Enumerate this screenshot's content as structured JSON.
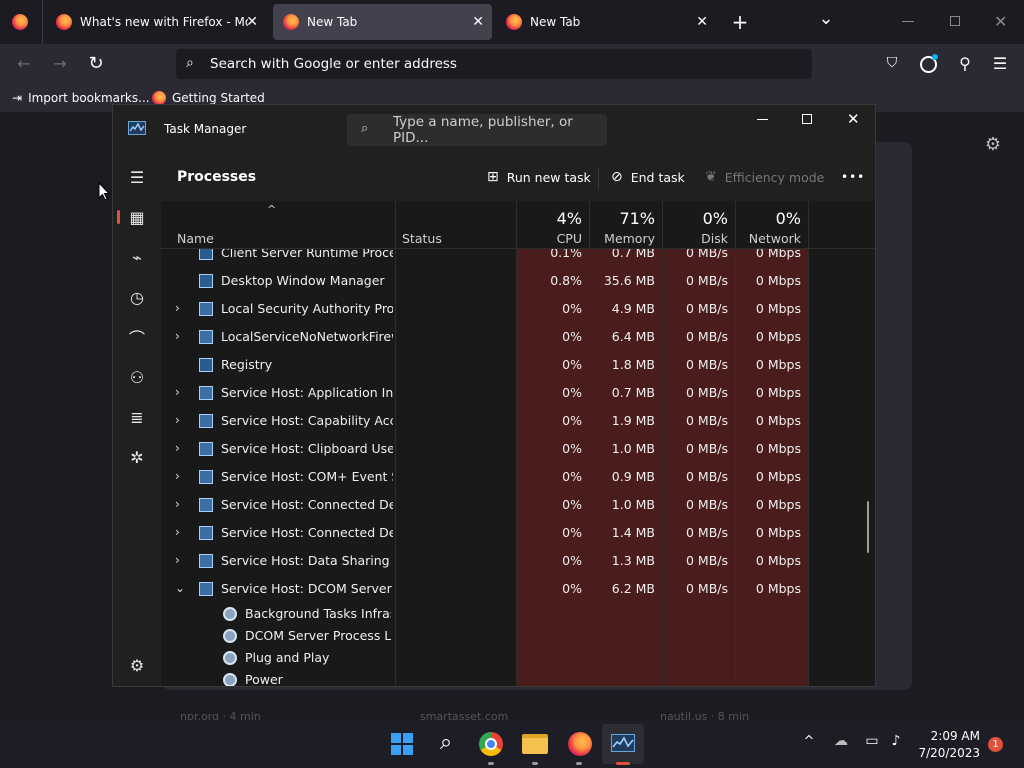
{
  "browser": {
    "tabs": [
      {
        "label": "What's new with Firefox - More",
        "close": "✕"
      },
      {
        "label": "New Tab",
        "close": "✕"
      },
      {
        "label": "New Tab",
        "close": "✕"
      }
    ],
    "new_tab": "+",
    "list_all_tabs": "⌄",
    "url_placeholder": "Search with Google or enter address",
    "bookmarks": [
      {
        "label": "Import bookmarks..."
      },
      {
        "label": "Getting Started"
      }
    ],
    "background_sites": [
      "npr.org · 4 min",
      "smartasset.com",
      "nautil.us · 8 min"
    ]
  },
  "task_manager": {
    "title": "Task Manager",
    "search_placeholder": "Type a name, publisher, or PID...",
    "page_title": "Processes",
    "commands": {
      "run_new_task": "Run new task",
      "end_task": "End task",
      "efficiency_mode": "Efficiency mode",
      "more": "•••"
    },
    "columns": {
      "name": "Name",
      "status": "Status",
      "cpu": {
        "label": "CPU",
        "pct": "4%"
      },
      "memory": {
        "label": "Memory",
        "pct": "71%"
      },
      "disk": {
        "label": "Disk",
        "pct": "0%"
      },
      "network": {
        "label": "Network",
        "pct": "0%"
      }
    },
    "rows": [
      {
        "name": "Client Server Runtime Process",
        "expand": "",
        "cpu": "0.1%",
        "mem": "0.7 MB",
        "disk": "0 MB/s",
        "net": "0 Mbps"
      },
      {
        "name": "Desktop Window Manager",
        "expand": "",
        "cpu": "0.8%",
        "mem": "35.6 MB",
        "disk": "0 MB/s",
        "net": "0 Mbps"
      },
      {
        "name": "Local Security Authority Proce...",
        "expand": "›",
        "cpu": "0%",
        "mem": "4.9 MB",
        "disk": "0 MB/s",
        "net": "0 Mbps"
      },
      {
        "name": "LocalServiceNoNetworkFirewa...",
        "expand": "›",
        "cpu": "0%",
        "mem": "6.4 MB",
        "disk": "0 MB/s",
        "net": "0 Mbps"
      },
      {
        "name": "Registry",
        "expand": "",
        "cpu": "0%",
        "mem": "1.8 MB",
        "disk": "0 MB/s",
        "net": "0 Mbps"
      },
      {
        "name": "Service Host: Application Infor...",
        "expand": "›",
        "cpu": "0%",
        "mem": "0.7 MB",
        "disk": "0 MB/s",
        "net": "0 Mbps"
      },
      {
        "name": "Service Host: Capability Acces...",
        "expand": "›",
        "cpu": "0%",
        "mem": "1.9 MB",
        "disk": "0 MB/s",
        "net": "0 Mbps"
      },
      {
        "name": "Service Host: Clipboard User S...",
        "expand": "›",
        "cpu": "0%",
        "mem": "1.0 MB",
        "disk": "0 MB/s",
        "net": "0 Mbps"
      },
      {
        "name": "Service Host: COM+ Event Sys...",
        "expand": "›",
        "cpu": "0%",
        "mem": "0.9 MB",
        "disk": "0 MB/s",
        "net": "0 Mbps"
      },
      {
        "name": "Service Host: Connected Devi...",
        "expand": "›",
        "cpu": "0%",
        "mem": "1.0 MB",
        "disk": "0 MB/s",
        "net": "0 Mbps"
      },
      {
        "name": "Service Host: Connected Devi...",
        "expand": "›",
        "cpu": "0%",
        "mem": "1.4 MB",
        "disk": "0 MB/s",
        "net": "0 Mbps"
      },
      {
        "name": "Service Host: Data Sharing Ser...",
        "expand": "›",
        "cpu": "0%",
        "mem": "1.3 MB",
        "disk": "0 MB/s",
        "net": "0 Mbps"
      },
      {
        "name": "Service Host: DCOM Server Pr...",
        "expand": "⌄",
        "cpu": "0%",
        "mem": "6.2 MB",
        "disk": "0 MB/s",
        "net": "0 Mbps"
      }
    ],
    "subrows": [
      {
        "name": "Background Tasks Infrastr..."
      },
      {
        "name": "DCOM Server Process Lau..."
      },
      {
        "name": "Plug and Play"
      },
      {
        "name": "Power"
      }
    ]
  },
  "taskbar": {
    "time": "2:09 AM",
    "date": "7/20/2023",
    "notification_count": "1"
  },
  "colors": {
    "heat": "#4a1c1c",
    "accent": "#e0503c",
    "tm_bg": "#191919"
  }
}
